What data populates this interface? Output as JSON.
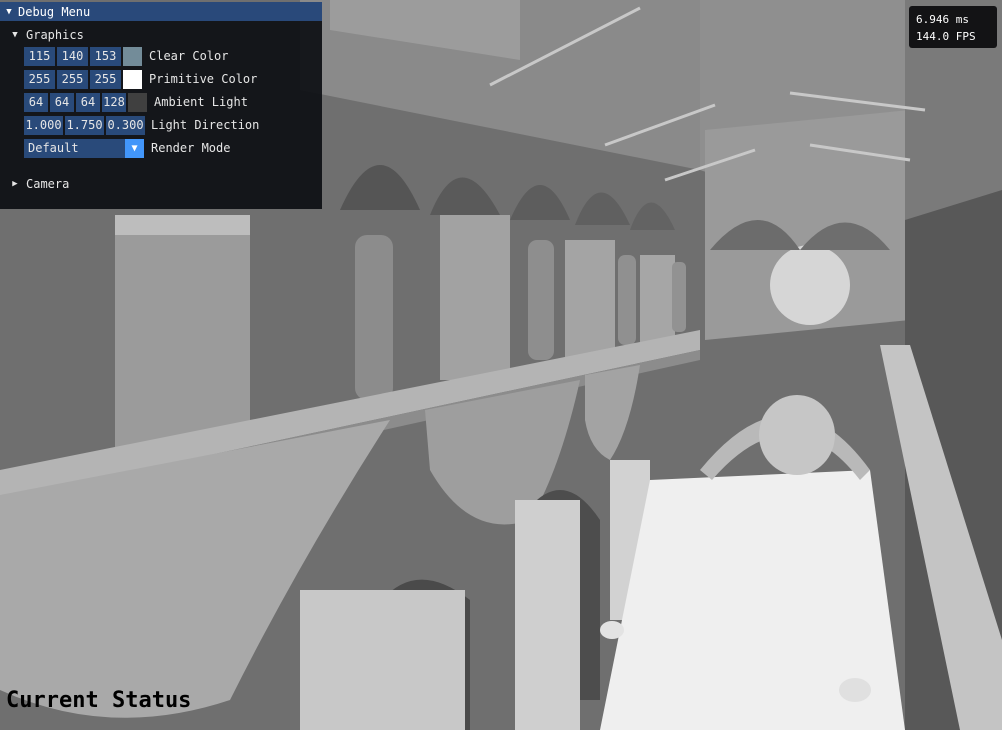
{
  "debug_menu": {
    "title": "Debug Menu",
    "graphics": {
      "header": "Graphics",
      "clear_color": {
        "r": "115",
        "g": "140",
        "b": "153",
        "label": "Clear Color",
        "swatch": "#738c99"
      },
      "primitive_color": {
        "r": "255",
        "g": "255",
        "b": "255",
        "label": "Primitive Color",
        "swatch": "#ffffff"
      },
      "ambient_light": {
        "r": "64",
        "g": "64",
        "b": "64",
        "a": "128",
        "label": "Ambient Light",
        "swatch": "#404040"
      },
      "light_direction": {
        "x": "1.000",
        "y": "1.750",
        "z": "0.300",
        "label": "Light Direction"
      },
      "render_mode": {
        "value": "Default",
        "label": "Render Mode"
      }
    },
    "camera": {
      "header": "Camera"
    }
  },
  "perf": {
    "frame_time": "6.946 ms",
    "fps": "144.0 FPS"
  },
  "status": {
    "text": "Current Status"
  }
}
